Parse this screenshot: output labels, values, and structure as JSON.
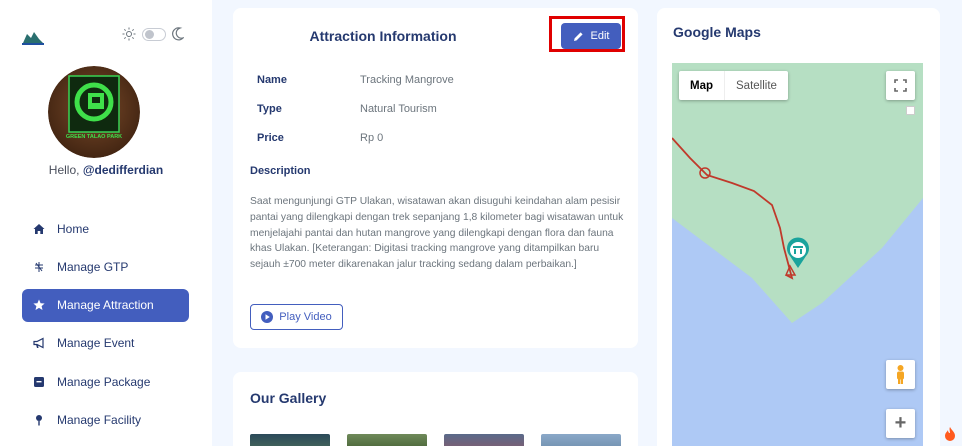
{
  "sidebar": {
    "greeting_prefix": "Hello, ",
    "username": "@dedifferdian",
    "avatar_text": "GREEN TALAO PARK",
    "items": [
      {
        "label": "Home",
        "icon": "home-icon"
      },
      {
        "label": "Manage GTP",
        "icon": "grid-icon"
      },
      {
        "label": "Manage Attraction",
        "icon": "star-icon",
        "active": true
      },
      {
        "label": "Manage Event",
        "icon": "megaphone-icon"
      },
      {
        "label": "Manage Package",
        "icon": "package-icon"
      },
      {
        "label": "Manage Facility",
        "icon": "pin-icon"
      }
    ]
  },
  "attraction": {
    "title": "Attraction Information",
    "edit_label": "Edit",
    "fields": [
      {
        "key": "Name",
        "value": "Tracking Mangrove"
      },
      {
        "key": "Type",
        "value": "Natural Tourism"
      },
      {
        "key": "Price",
        "value": "Rp 0"
      }
    ],
    "description_label": "Description",
    "description": "Saat mengunjungi GTP Ulakan, wisatawan akan disuguhi keindahan alam pesisir pantai yang dilengkapi dengan trek sepanjang 1,8 kilometer bagi wisatawan untuk menjelajahi pantai dan hutan mangrove yang dilengkapi dengan flora dan fauna khas Ulakan. [Keterangan: Digitasi tracking mangrove yang ditampilkan baru sejauh ±700 meter dikarenakan jalur tracking sedang dalam perbaikan.]",
    "play_label": "Play Video"
  },
  "gallery": {
    "title": "Our Gallery"
  },
  "map": {
    "title": "Google Maps",
    "map_label": "Map",
    "satellite_label": "Satellite",
    "zoom_in": "+"
  },
  "colors": {
    "primary": "#435ebe",
    "highlight": "#e00000",
    "land": "#b6dfc3",
    "water": "#aec9f5",
    "route": "#c0392b"
  }
}
